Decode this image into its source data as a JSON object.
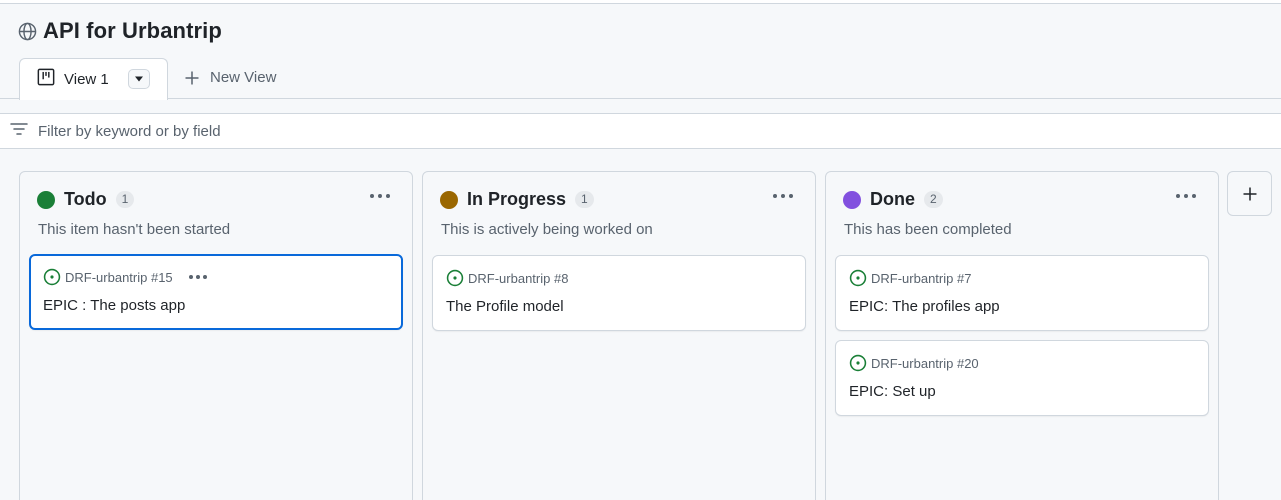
{
  "project": {
    "title": "API for Urbantrip",
    "icon": "globe-icon"
  },
  "views": {
    "tabs": [
      {
        "label": "View 1",
        "icon": "board-icon",
        "active": true
      }
    ],
    "new_view_label": "New View"
  },
  "filter": {
    "placeholder": "Filter by keyword or by field",
    "value": ""
  },
  "columns": [
    {
      "title": "Todo",
      "count": "1",
      "color": "#1a7f37",
      "description": "This item hasn't been started",
      "cards": [
        {
          "ref": "DRF-urbantrip #15",
          "title": "EPIC : The posts app",
          "selected": true
        }
      ]
    },
    {
      "title": "In Progress",
      "count": "1",
      "color": "#9a6700",
      "description": "This is actively being worked on",
      "cards": [
        {
          "ref": "DRF-urbantrip #8",
          "title": "The Profile model"
        }
      ]
    },
    {
      "title": "Done",
      "count": "2",
      "color": "#8250df",
      "description": "This has been completed",
      "cards": [
        {
          "ref": "DRF-urbantrip #7",
          "title": "EPIC: The profiles app"
        },
        {
          "ref": "DRF-urbantrip #20",
          "title": "EPIC: Set up"
        }
      ]
    }
  ],
  "colors": {
    "accent": "#0969da",
    "open_issue": "#1a7f37"
  }
}
